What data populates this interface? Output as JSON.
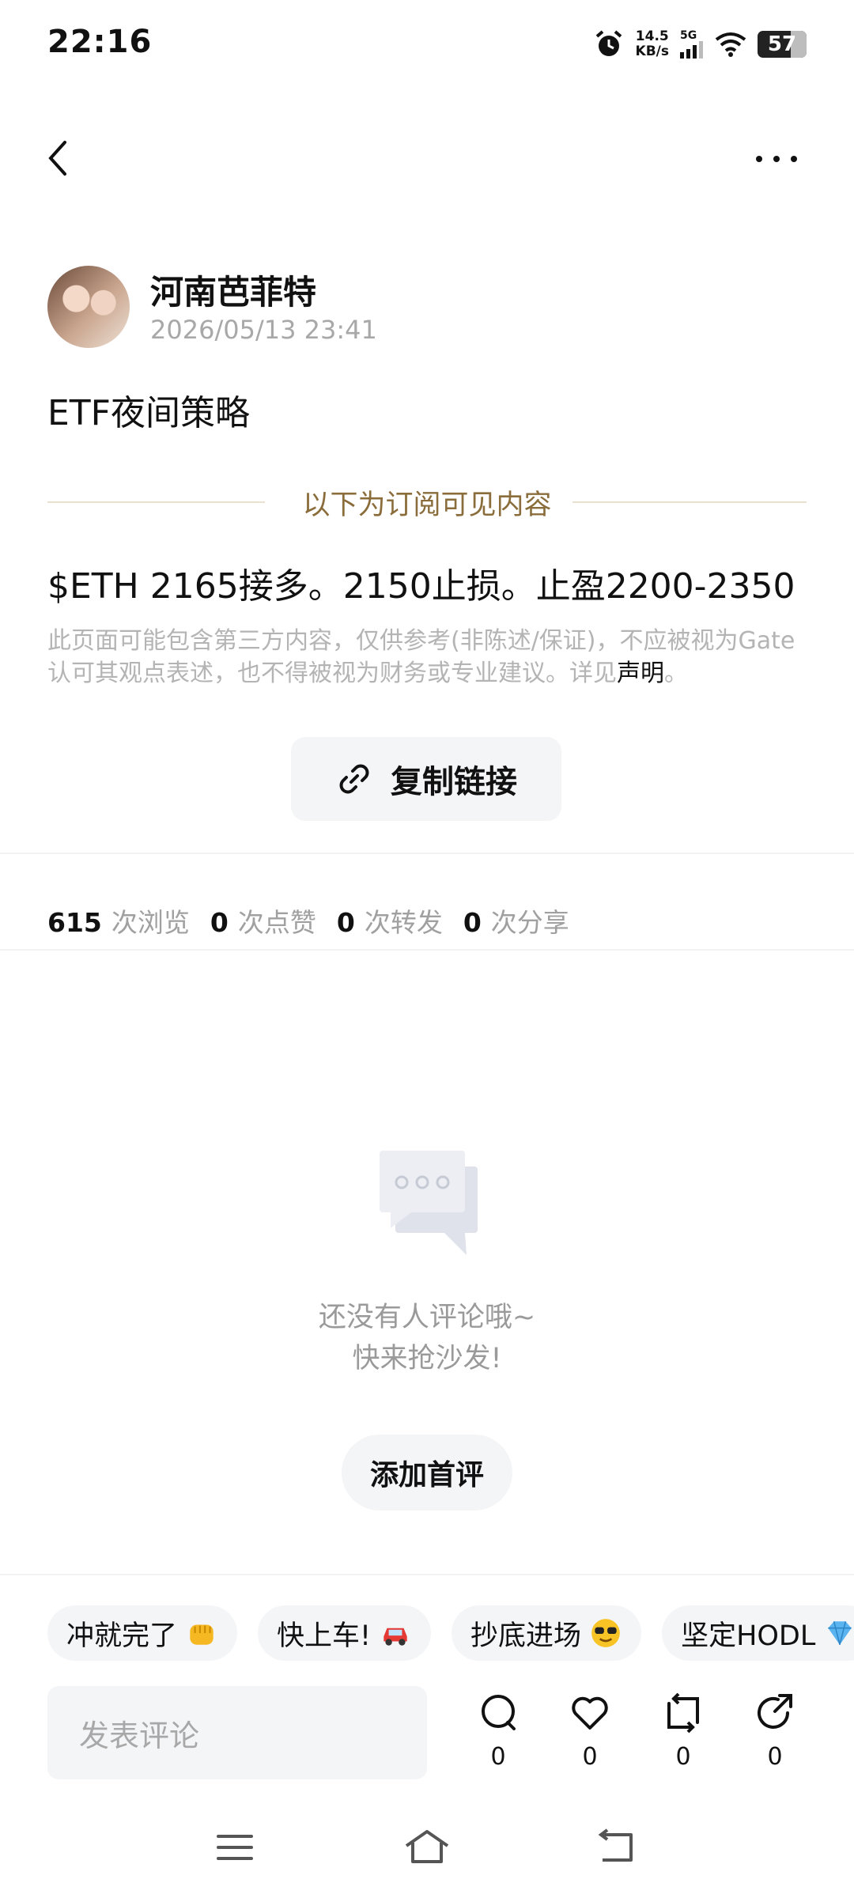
{
  "status_bar": {
    "time": "22:16",
    "net_speed_value": "14.5",
    "net_speed_unit": "KB/s",
    "network": "5G",
    "battery": "57"
  },
  "post": {
    "author_name": "河南芭菲特",
    "timestamp": "2026/05/13 23:41",
    "title": "ETF夜间策略",
    "subscriber_divider": "以下为订阅可见内容",
    "body": "$ETH 2165接多。2150止损。止盈2200-2350",
    "disclaimer": "此页面可能包含第三方内容，仅供参考(非陈述/保证)，不应被视为Gate认可其观点表述，也不得被视为财务或专业建议。详见",
    "disclaimer_link": "声明",
    "disclaimer_end": "。",
    "copy_link_label": "复制链接"
  },
  "stats": [
    {
      "value": "615",
      "label": "次浏览"
    },
    {
      "value": "0",
      "label": "次点赞"
    },
    {
      "value": "0",
      "label": "次转发"
    },
    {
      "value": "0",
      "label": "次分享"
    }
  ],
  "comments": {
    "empty_line1": "还没有人评论哦~",
    "empty_line2": "快来抢沙发!",
    "first_comment_label": "添加首评"
  },
  "quick_replies": [
    {
      "label": "冲就完了",
      "icon": "fist-emoji"
    },
    {
      "label": "快上车!",
      "icon": "car-emoji"
    },
    {
      "label": "抄底进场",
      "icon": "sunglasses-emoji"
    },
    {
      "label": "坚定HODL",
      "icon": "gem-emoji"
    }
  ],
  "bottom_bar": {
    "comment_placeholder": "发表评论",
    "comment_count": "0",
    "like_count": "0",
    "repost_count": "0",
    "share_count": "0"
  },
  "colors": {
    "accent_gold": "#8a6d3b",
    "muted_text": "#a8a8a8",
    "chip_bg": "#f4f5f7"
  }
}
